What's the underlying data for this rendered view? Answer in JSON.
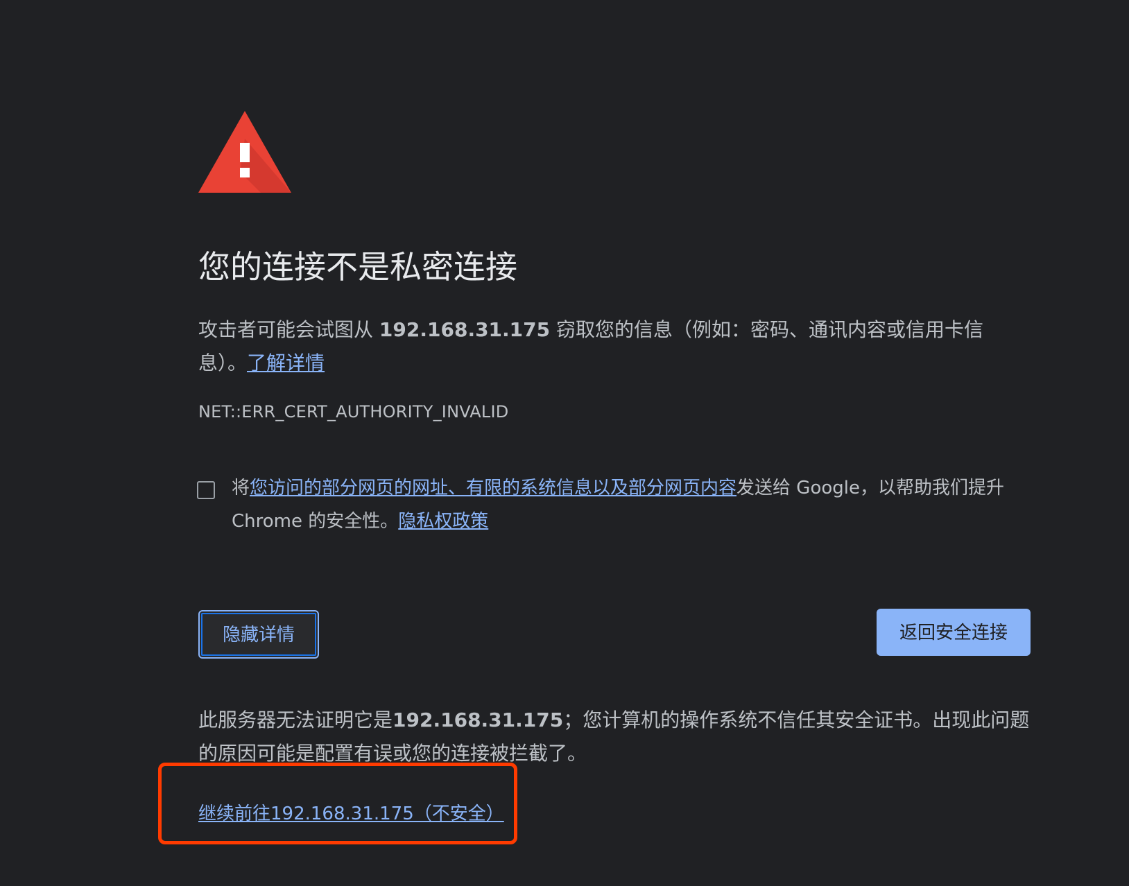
{
  "title": "您的连接不是私密连接",
  "main": {
    "prefix": "攻击者可能会试图从 ",
    "host": "192.168.31.175",
    "suffix": " 窃取您的信息（例如：密码、通讯内容或信用卡信息）。",
    "learn_more": "了解详情"
  },
  "error_code": "NET::ERR_CERT_AUTHORITY_INVALID",
  "report": {
    "prefix": "将",
    "link": "您访问的部分网页的网址、有限的系统信息以及部分网页内容",
    "middle": "发送给 Google，以帮助我们提升 Chrome 的安全性。",
    "privacy_link": "隐私权政策",
    "checked": false
  },
  "buttons": {
    "hide_details": "隐藏详情",
    "back_to_safety": "返回安全连接"
  },
  "details": {
    "prefix": "此服务器无法证明它是",
    "host": "192.168.31.175",
    "suffix": "；您计算机的操作系统不信任其安全证书。出现此问题的原因可能是配置有误或您的连接被拦截了。"
  },
  "proceed_link": "继续前往192.168.31.175（不安全）",
  "colors": {
    "background": "#202124",
    "text": "#bdc1c6",
    "title": "#e8eaed",
    "link": "#8ab4f8",
    "warning_red": "#e94235",
    "annotation_box": "#ff3b00"
  },
  "icons": {
    "warning": "warning-triangle-icon"
  }
}
